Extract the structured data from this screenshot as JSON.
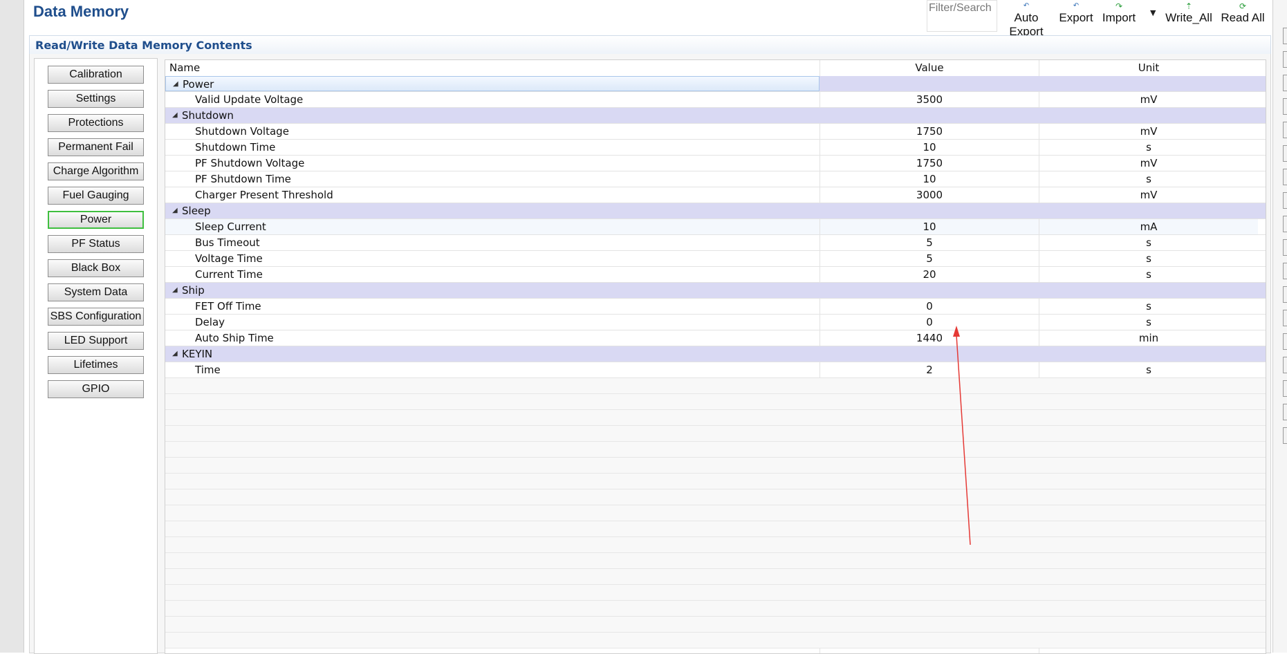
{
  "window": {
    "title": "Data Memory"
  },
  "toolbar": {
    "filter_placeholder": "Filter/Search",
    "auto_export": "Auto Export",
    "export": "Export",
    "import": "Import",
    "write_all": "Write_All",
    "read_all": "Read All"
  },
  "section": {
    "title": "Read/Write Data Memory Contents"
  },
  "nav": {
    "items": [
      {
        "label": "Calibration"
      },
      {
        "label": "Settings"
      },
      {
        "label": "Protections"
      },
      {
        "label": "Permanent Fail"
      },
      {
        "label": "Charge Algorithm"
      },
      {
        "label": "Fuel Gauging"
      },
      {
        "label": "Power",
        "active": true
      },
      {
        "label": "PF Status"
      },
      {
        "label": "Black Box"
      },
      {
        "label": "System Data"
      },
      {
        "label": "SBS Configuration"
      },
      {
        "label": "LED Support"
      },
      {
        "label": "Lifetimes"
      },
      {
        "label": "GPIO"
      }
    ]
  },
  "table": {
    "columns": {
      "name": "Name",
      "value": "Value",
      "unit": "Unit"
    },
    "rows": [
      {
        "group": true,
        "name": "Power"
      },
      {
        "name": "Valid Update Voltage",
        "value": "3500",
        "unit": "mV"
      },
      {
        "group": true,
        "name": "Shutdown"
      },
      {
        "name": "Shutdown Voltage",
        "value": "1750",
        "unit": "mV"
      },
      {
        "name": "Shutdown Time",
        "value": "10",
        "unit": "s"
      },
      {
        "name": "PF Shutdown Voltage",
        "value": "1750",
        "unit": "mV"
      },
      {
        "name": "PF Shutdown Time",
        "value": "10",
        "unit": "s"
      },
      {
        "name": "Charger Present Threshold",
        "value": "3000",
        "unit": "mV"
      },
      {
        "group": true,
        "name": "Sleep"
      },
      {
        "name": "Sleep Current",
        "value": "10",
        "unit": "mA"
      },
      {
        "name": "Bus Timeout",
        "value": "5",
        "unit": "s"
      },
      {
        "name": "Voltage Time",
        "value": "5",
        "unit": "s"
      },
      {
        "name": "Current Time",
        "value": "20",
        "unit": "s"
      },
      {
        "group": true,
        "name": "Ship"
      },
      {
        "name": "FET Off Time",
        "value": "0",
        "unit": "s"
      },
      {
        "name": "Delay",
        "value": "0",
        "unit": "s"
      },
      {
        "name": "Auto Ship Time",
        "value": "1440",
        "unit": "min"
      },
      {
        "group": true,
        "name": "KEYIN"
      },
      {
        "name": "Time",
        "value": "2",
        "unit": "s"
      }
    ]
  },
  "icons": {
    "expanded": "triangle-expanded-icon",
    "export": "export-icon",
    "import": "import-icon",
    "write": "write-icon",
    "refresh": "refresh-icon"
  },
  "colors": {
    "title_blue": "#1f4e8c",
    "group_row": "#d9d9f3",
    "active_border": "#3fbf3f",
    "annotation_arrow": "#e53935"
  }
}
